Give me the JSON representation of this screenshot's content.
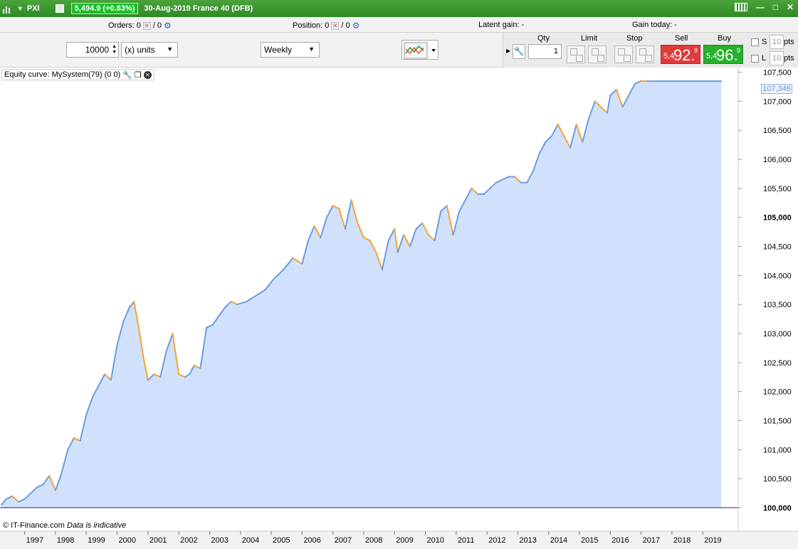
{
  "titlebar": {
    "symbol": "PXI",
    "price_change": "5,494.9 (+0.83%)",
    "date_instrument": "30-Aug-2019 France 40 (DFB)",
    "minimize_glyph": "—",
    "maximize_glyph": "□",
    "close_glyph": "✕"
  },
  "infobar": {
    "orders_label": "Orders:",
    "orders_count": "0",
    "orders_count2": "/ 0",
    "position_label": "Position:",
    "position_count": "0",
    "position_count2": "/ 0",
    "latent_label": "Latent gain:",
    "latent_value": "-",
    "gain_today_label": "Gain today:",
    "gain_today_value": "-"
  },
  "toolbar": {
    "quantity_value": "10000",
    "units_value": "(x) units",
    "timeframe_value": "Weekly"
  },
  "trade_panel": {
    "qty_label": "Qty",
    "qty_value": "1",
    "limit_label": "Limit",
    "stop_label": "Stop",
    "sell_label": "Sell",
    "buy_label": "Buy",
    "sell_price_small": "5,4",
    "sell_price_big": "92.",
    "sell_price_sup": "9",
    "buy_price_small": "5,4",
    "buy_price_big": "96.",
    "buy_price_sup": "9",
    "s_label": "S",
    "l_label": "L",
    "pts_value": "10",
    "pts_label": "pts"
  },
  "legend": {
    "text": "Equity curve: MySystem(79) (0 0)"
  },
  "copyright": {
    "source": "© IT-Finance.com",
    "note": "Data is indicative"
  },
  "colors": {
    "line_up": "#6b9be4",
    "line_down": "#f5a233",
    "area_fill": "#d2e1fb",
    "baseline": "#1a2a8a",
    "last_value_text": "#6b8fd3"
  },
  "chart_data": {
    "type": "area",
    "title": "",
    "xlabel": "",
    "ylabel": "",
    "ylim": [
      99950,
      107580
    ],
    "xlim": [
      1996.2,
      2020.15
    ],
    "baseline": 100000,
    "last_value_label": "107,346",
    "y_ticks": [
      100000,
      100500,
      101000,
      101500,
      102000,
      102500,
      103000,
      103500,
      104000,
      104500,
      105000,
      105500,
      106000,
      106500,
      107000,
      107500
    ],
    "y_tick_labels": [
      "100,000",
      "100,500",
      "101,000",
      "101,500",
      "102,000",
      "102,500",
      "103,000",
      "103,500",
      "104,000",
      "104,500",
      "105,000",
      "105,500",
      "106,000",
      "106,500",
      "107,000",
      "107,500"
    ],
    "y_bold_ticks": [
      100000,
      105000
    ],
    "x_ticks": [
      1997,
      1998,
      1999,
      2000,
      2001,
      2002,
      2003,
      2004,
      2005,
      2006,
      2007,
      2008,
      2009,
      2010,
      2011,
      2012,
      2013,
      2014,
      2015,
      2016,
      2017,
      2018,
      2019
    ],
    "x_tick_labels": [
      "1997",
      "1998",
      "1999",
      "2000",
      "2001",
      "2002",
      "2003",
      "2004",
      "2005",
      "2006",
      "2007",
      "2008",
      "2009",
      "2010",
      "2011",
      "2012",
      "2013",
      "2014",
      "2015",
      "2016",
      "2017",
      "2018",
      "2019"
    ],
    "x": [
      1996.25,
      1996.4,
      1996.6,
      1996.8,
      1997.0,
      1997.2,
      1997.4,
      1997.6,
      1997.8,
      1998.0,
      1998.2,
      1998.4,
      1998.6,
      1998.8,
      1999.0,
      1999.2,
      1999.4,
      1999.6,
      1999.8,
      2000.0,
      2000.2,
      2000.4,
      2000.55,
      2000.7,
      2000.85,
      2001.0,
      2001.2,
      2001.4,
      2001.6,
      2001.8,
      2002.0,
      2002.2,
      2002.35,
      2002.5,
      2002.7,
      2002.9,
      2003.1,
      2003.3,
      2003.5,
      2003.7,
      2003.9,
      2004.2,
      2004.5,
      2004.8,
      2005.1,
      2005.4,
      2005.7,
      2006.0,
      2006.2,
      2006.4,
      2006.6,
      2006.8,
      2007.0,
      2007.2,
      2007.4,
      2007.6,
      2007.8,
      2008.0,
      2008.2,
      2008.4,
      2008.6,
      2008.8,
      2009.0,
      2009.1,
      2009.3,
      2009.5,
      2009.7,
      2009.9,
      2010.1,
      2010.3,
      2010.5,
      2010.7,
      2010.9,
      2011.1,
      2011.3,
      2011.5,
      2011.7,
      2011.9,
      2012.1,
      2012.3,
      2012.5,
      2012.7,
      2012.9,
      2013.1,
      2013.3,
      2013.5,
      2013.7,
      2013.9,
      2014.1,
      2014.3,
      2014.5,
      2014.7,
      2014.9,
      2015.1,
      2015.3,
      2015.5,
      2015.7,
      2015.9,
      2016.0,
      2016.2,
      2016.4,
      2016.6,
      2016.8,
      2017.0,
      2017.2,
      2017.4,
      2017.6,
      2017.8,
      2018.0,
      2018.2,
      2018.4,
      2018.6,
      2018.8,
      2019.0,
      2019.2,
      2019.4,
      2019.6
    ],
    "values": [
      100050,
      100150,
      100200,
      100100,
      100150,
      100250,
      100350,
      100400,
      100550,
      100300,
      100600,
      101000,
      101200,
      101150,
      101600,
      101900,
      102100,
      102300,
      102200,
      102800,
      103200,
      103450,
      103550,
      103100,
      102600,
      102200,
      102300,
      102250,
      102700,
      103000,
      102300,
      102250,
      102300,
      102450,
      102400,
      103100,
      103150,
      103300,
      103450,
      103550,
      103500,
      103550,
      103650,
      103750,
      103950,
      104100,
      104300,
      104200,
      104600,
      104850,
      104650,
      105000,
      105200,
      105150,
      104800,
      105300,
      104900,
      104650,
      104600,
      104400,
      104100,
      104600,
      104800,
      104400,
      104700,
      104500,
      104800,
      104900,
      104700,
      104600,
      105100,
      105200,
      104700,
      105100,
      105300,
      105500,
      105400,
      105400,
      105500,
      105600,
      105650,
      105700,
      105700,
      105600,
      105600,
      105800,
      106100,
      106300,
      106400,
      106600,
      106400,
      106200,
      106600,
      106300,
      106700,
      107000,
      106900,
      106800,
      107100,
      107200,
      106900,
      107100,
      107300,
      107350,
      107346,
      107346,
      107346,
      107346,
      107346,
      107346,
      107346,
      107346,
      107346,
      107346,
      107346,
      107346,
      107346
    ]
  }
}
